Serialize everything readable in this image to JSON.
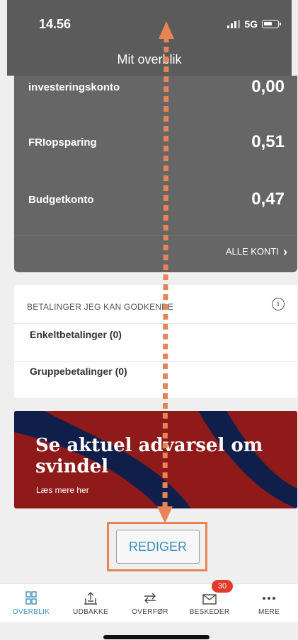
{
  "status_bar": {
    "time": "14.56",
    "network": "5G"
  },
  "nav": {
    "title": "Mit overblik"
  },
  "accounts": {
    "items": [
      {
        "name": "investeringskonto",
        "value": "0,00"
      },
      {
        "name": "FRIopsparing",
        "value": "0,51"
      },
      {
        "name": "Budgetkonto",
        "value": "0,47"
      }
    ],
    "all_label": "ALLE KONTI"
  },
  "payments": {
    "header": "BETALINGER JEG KAN GODKENDE",
    "items": [
      "Enkeltbetalinger (0)",
      "Gruppebetalinger (0)"
    ]
  },
  "banner": {
    "title": "Se aktuel advarsel om svindel",
    "subtitle": "Læs mere her",
    "colors": {
      "background": "#8e1a1a",
      "stripe": "#0f1f4a"
    }
  },
  "edit": {
    "label": "REDIGER"
  },
  "annotation": {
    "color": "#e68456"
  },
  "tabbar": {
    "items": [
      {
        "label": "OVERBLIK",
        "icon": "grid-icon",
        "active": true
      },
      {
        "label": "UDBAKKE",
        "icon": "outbox-icon"
      },
      {
        "label": "OVERFØR",
        "icon": "transfer-icon"
      },
      {
        "label": "BESKEDER",
        "icon": "mail-icon",
        "badge": "30"
      },
      {
        "label": "MERE",
        "icon": "more-icon"
      }
    ]
  }
}
